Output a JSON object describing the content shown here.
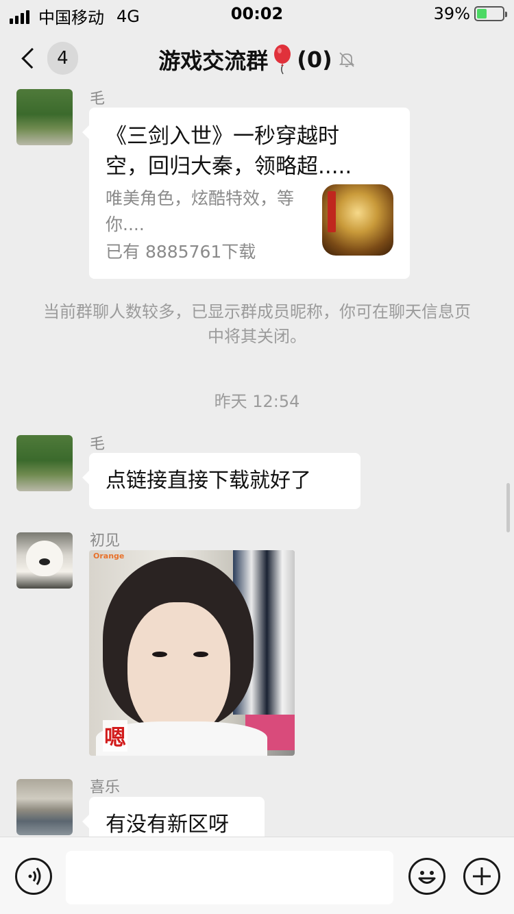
{
  "status_bar": {
    "carrier": "中国移动",
    "network": "4G",
    "time": "00:02",
    "battery": "39%",
    "battery_level": 0.39
  },
  "nav": {
    "back_count": "4",
    "title": "游戏交流群",
    "member_suffix": "(0)",
    "icons": [
      "chevron-left-icon",
      "balloon-icon",
      "muted-bell-icon"
    ]
  },
  "messages": [
    {
      "sender": "毛",
      "type": "link-card",
      "title": "《三剑入世》一秒穿越时空，回归大秦，领略超.....",
      "description": "唯美角色，炫酷特效，等你....",
      "download_count": "已有 8885761下载"
    },
    {
      "type": "system-notice",
      "text": "当前群聊人数较多，已显示群成员昵称，你可在聊天信息页中将其关闭。"
    },
    {
      "type": "timestamp",
      "text": "昨天 12:54"
    },
    {
      "sender": "毛",
      "type": "text",
      "text": "点链接直接下载就好了"
    },
    {
      "sender": "初见",
      "type": "sticker",
      "brand": "Orange",
      "caption": "嗯"
    },
    {
      "sender": "喜乐",
      "type": "text",
      "text": "有没有新区呀"
    }
  ],
  "input_bar": {
    "placeholder": "",
    "icons": [
      "voice-icon",
      "emoji-icon",
      "plus-icon"
    ]
  },
  "colors": {
    "background": "#ededed",
    "bubble": "#ffffff",
    "meta_text": "#9b9b9b",
    "battery_fill": "#4cd964",
    "balloon": "#e0313b"
  }
}
